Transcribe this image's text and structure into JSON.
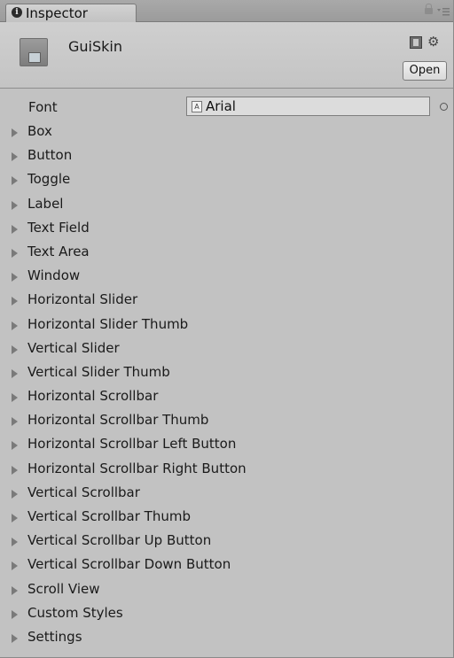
{
  "tab": {
    "title": "Inspector"
  },
  "header": {
    "asset_name": "GuiSkin",
    "open_label": "Open"
  },
  "font_row": {
    "label": "Font",
    "value": "Arial"
  },
  "foldouts": [
    "Box",
    "Button",
    "Toggle",
    "Label",
    "Text Field",
    "Text Area",
    "Window",
    "Horizontal Slider",
    "Horizontal Slider Thumb",
    "Vertical Slider",
    "Vertical Slider Thumb",
    "Horizontal Scrollbar",
    "Horizontal Scrollbar Thumb",
    "Horizontal Scrollbar Left Button",
    "Horizontal Scrollbar Right Button",
    "Vertical Scrollbar",
    "Vertical Scrollbar Thumb",
    "Vertical Scrollbar Up Button",
    "Vertical Scrollbar Down Button",
    "Scroll View",
    "Custom Styles",
    "Settings"
  ],
  "icons": {
    "tab_icon": "info-icon",
    "lock": "lock-icon",
    "menu": "context-menu-icon",
    "asset": "guiskin-asset-icon",
    "help": "help-book-icon",
    "settings": "gear-icon",
    "font_asset": "font-asset-icon",
    "picker": "object-picker-icon",
    "foldout": "foldout-arrow-icon"
  }
}
